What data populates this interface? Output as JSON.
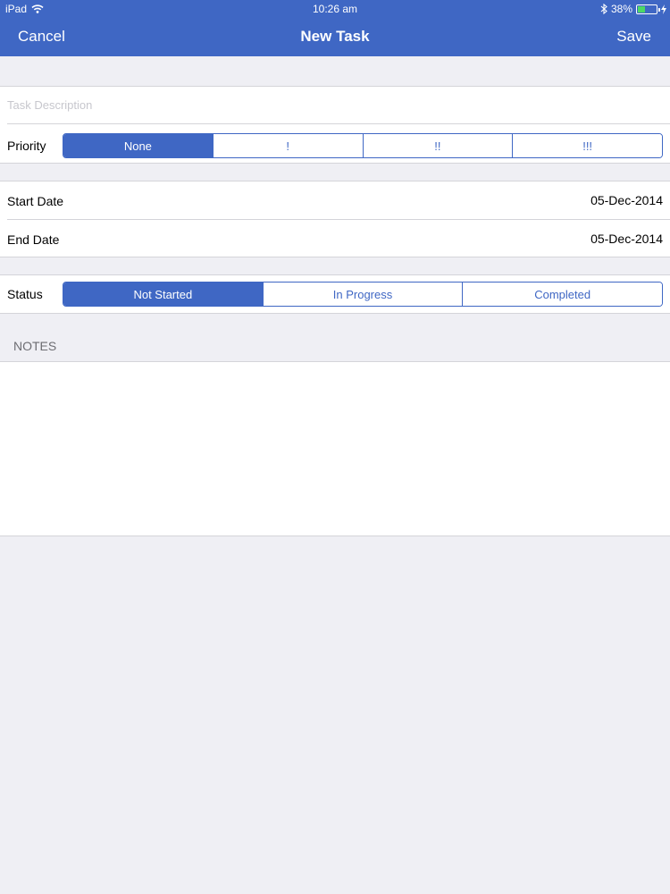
{
  "status_bar": {
    "device": "iPad",
    "time": "10:26 am",
    "battery": "38%",
    "icons": [
      "wifi-icon",
      "bluetooth-icon",
      "battery-icon",
      "charging-icon"
    ]
  },
  "nav": {
    "cancel_label": "Cancel",
    "title": "New Task",
    "save_label": "Save"
  },
  "form": {
    "task_description": {
      "value": "",
      "placeholder": "Task Description"
    },
    "priority": {
      "label": "Priority",
      "options": [
        "None",
        "!",
        "!!",
        "!!!"
      ],
      "selected": "None"
    },
    "start_date": {
      "label": "Start Date",
      "value": "05-Dec-2014"
    },
    "end_date": {
      "label": "End Date",
      "value": "05-Dec-2014"
    },
    "status": {
      "label": "Status",
      "options": [
        "Not Started",
        "In Progress",
        "Completed"
      ],
      "selected": "Not Started"
    },
    "notes": {
      "header": "NOTES",
      "value": ""
    }
  },
  "colors": {
    "accent": "#3f67c4",
    "background": "#efeff4",
    "separator": "#d4d4d9"
  }
}
